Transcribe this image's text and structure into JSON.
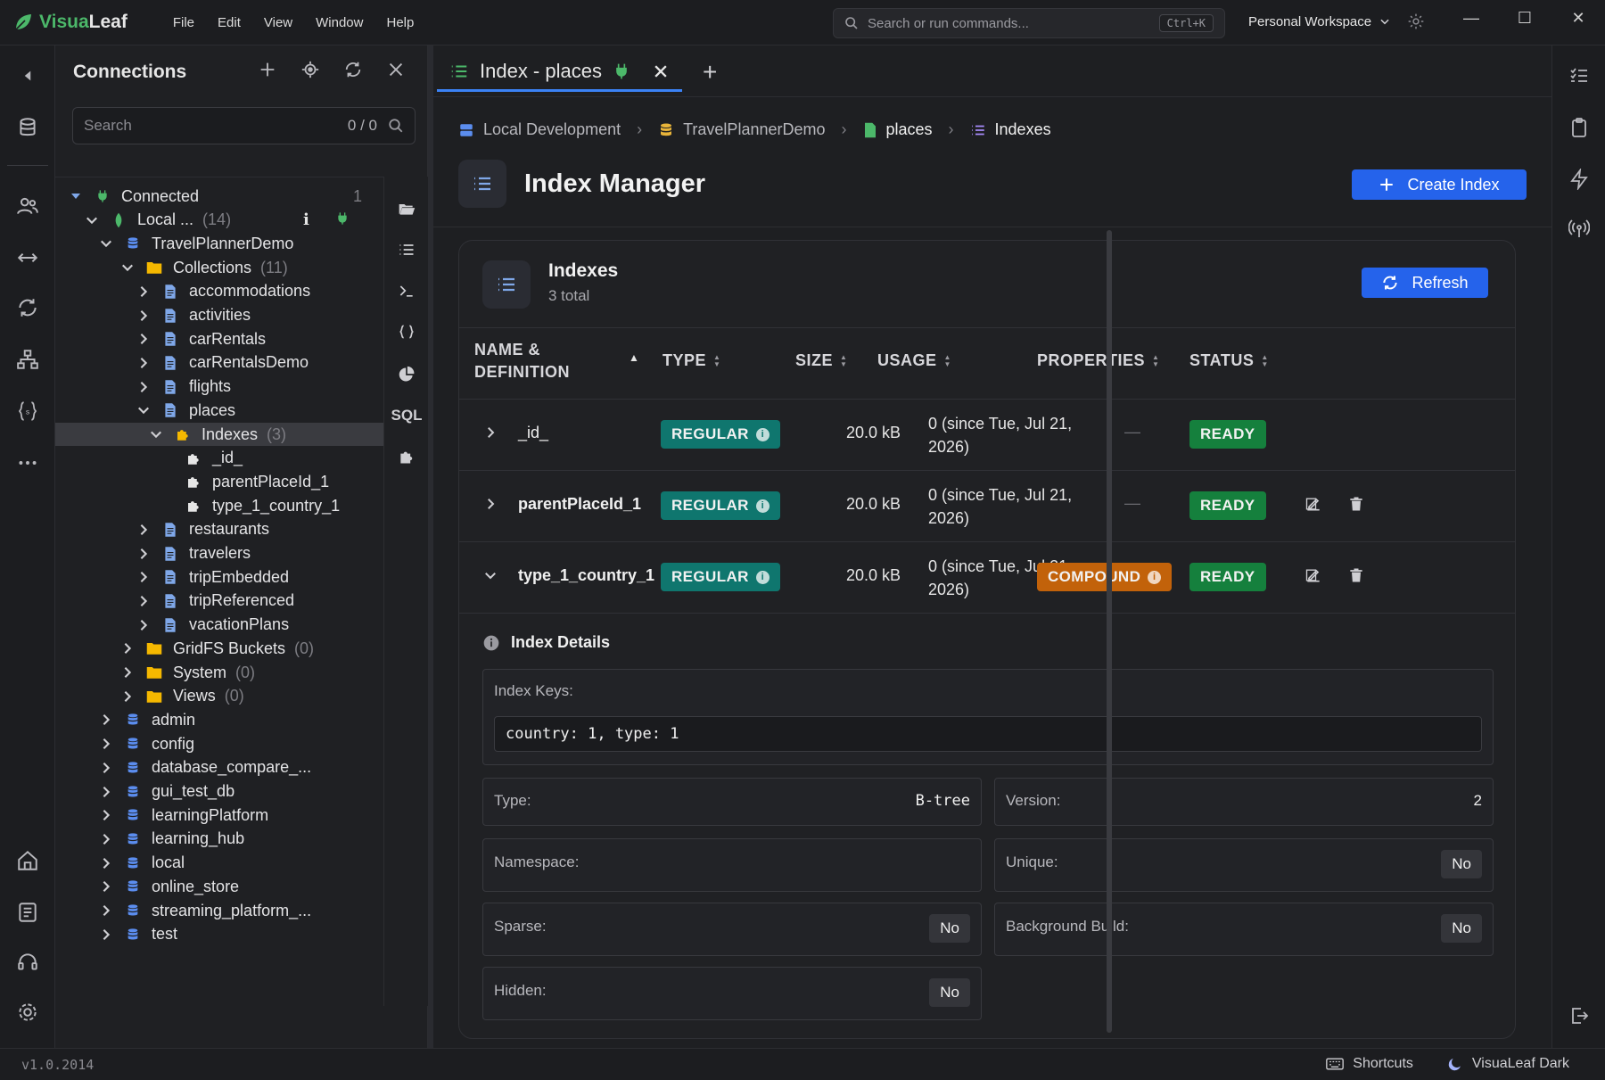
{
  "app": {
    "name_part1": "Visua",
    "name_part2": "Leaf"
  },
  "menu": [
    "File",
    "Edit",
    "View",
    "Window",
    "Help"
  ],
  "command_search": {
    "placeholder": "Search or run commands...",
    "shortcut": "Ctrl+K"
  },
  "workspace": "Personal Workspace",
  "connections": {
    "title": "Connections",
    "search_placeholder": "Search",
    "search_count": "0 / 0",
    "tree": {
      "connected_label": "Connected",
      "connected_count": "1",
      "local_label": "Local ...",
      "local_count": "(14)",
      "db": "TravelPlannerDemo",
      "collections_label": "Collections",
      "collections_count": "(11)",
      "collections": [
        "accommodations",
        "activities",
        "carRentals",
        "carRentalsDemo",
        "flights",
        "places"
      ],
      "indexes_label": "Indexes",
      "indexes_count": "(3)",
      "index_items": [
        "_id_",
        "parentPlaceId_1",
        "type_1_country_1"
      ],
      "collections_after": [
        "restaurants",
        "travelers",
        "tripEmbedded",
        "tripReferenced",
        "vacationPlans"
      ],
      "folders": [
        {
          "label": "GridFS Buckets",
          "count": "(0)"
        },
        {
          "label": "System",
          "count": "(0)"
        },
        {
          "label": "Views",
          "count": "(0)"
        }
      ],
      "databases": [
        "admin",
        "config",
        "database_compare_...",
        "gui_test_db",
        "learningPlatform",
        "learning_hub",
        "local",
        "online_store",
        "streaming_platform_...",
        "test"
      ]
    },
    "side_tool_sql": "SQL"
  },
  "tab": {
    "label": "Index - places"
  },
  "breadcrumb": [
    "Local Development",
    "TravelPlannerDemo",
    "places",
    "Indexes"
  ],
  "page": {
    "title": "Index Manager",
    "create_button": "Create Index"
  },
  "card": {
    "title": "Indexes",
    "subtitle": "3 total",
    "refresh_button": "Refresh",
    "columns": {
      "name_line1": "NAME &",
      "name_line2": "DEFINITION",
      "type": "TYPE",
      "size": "SIZE",
      "usage": "USAGE",
      "properties": "PROPERTIES",
      "status": "STATUS"
    },
    "rows": [
      {
        "name": "_id_",
        "type": "REGULAR",
        "size": "20.0 kB",
        "usage_line1": "0 (since Tue, Jul 21,",
        "usage_line2": "2026)",
        "properties": "—",
        "status": "READY"
      },
      {
        "name": "parentPlaceId_1",
        "type": "REGULAR",
        "size": "20.0 kB",
        "usage_line1": "0 (since Tue, Jul 21,",
        "usage_line2": "2026)",
        "properties": "—",
        "status": "READY"
      },
      {
        "name": "type_1_country_1",
        "type": "REGULAR",
        "size": "20.0 kB",
        "usage_line1": "0 (since Tue, Jul 21,",
        "usage_line2": "2026)",
        "properties": "COMPOUND",
        "status": "READY"
      }
    ]
  },
  "details": {
    "title": "Index Details",
    "keys_label": "Index Keys:",
    "keys_value": "country: 1, type: 1",
    "type_label": "Type:",
    "type_value": "B-tree",
    "version_label": "Version:",
    "version_value": "2",
    "namespace_label": "Namespace:",
    "namespace_value": "",
    "unique_label": "Unique:",
    "unique_value": "No",
    "sparse_label": "Sparse:",
    "sparse_value": "No",
    "background_label": "Background Build:",
    "background_value": "No",
    "hidden_label": "Hidden:",
    "hidden_value": "No"
  },
  "status_bar": {
    "version": "v1.0.2014",
    "shortcuts": "Shortcuts",
    "theme": "VisuaLeaf Dark"
  },
  "colors": {
    "accent": "#2563eb",
    "regular": "#0f766e",
    "compound": "#c2620a",
    "ready": "#15803d",
    "connected": "#4cb86a"
  }
}
